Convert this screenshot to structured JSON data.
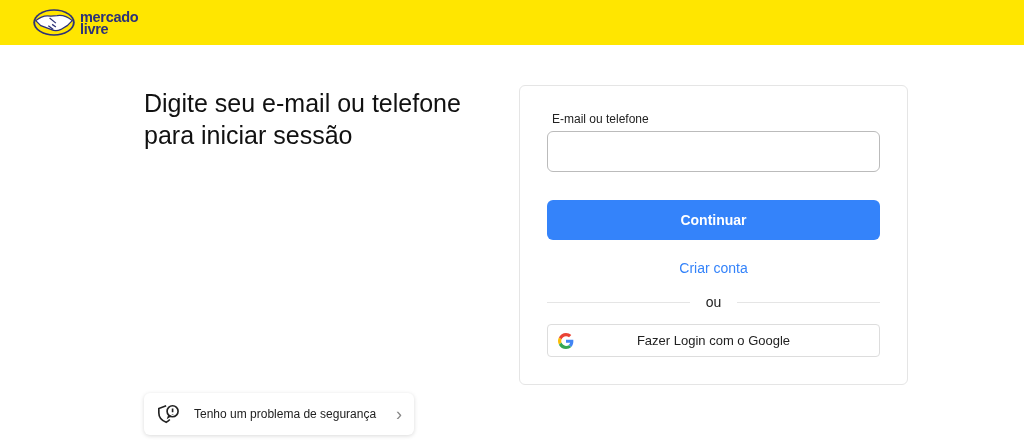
{
  "header": {
    "logo_text": [
      "mercado",
      "livre"
    ]
  },
  "heading": "Digite seu e-mail ou telefone para iniciar sessão",
  "form": {
    "field_label": "E-mail ou telefone",
    "continue_button": "Continuar",
    "create_account_link": "Criar conta",
    "divider_text": "ou",
    "google_button": "Fazer Login com o Google"
  },
  "security_link": {
    "label": "Tenho um problema de segurança",
    "chevron": "›"
  }
}
